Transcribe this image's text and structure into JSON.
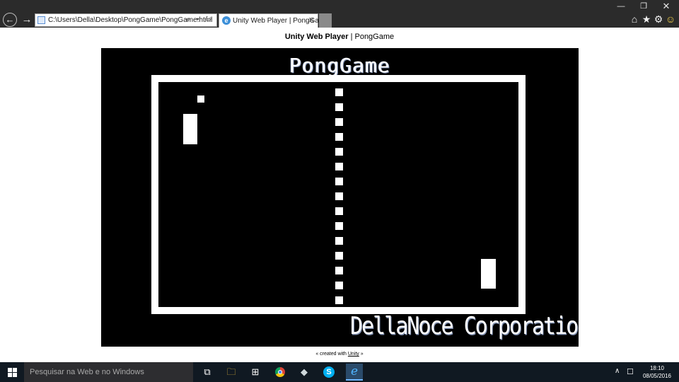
{
  "browser": {
    "address": "C:\\Users\\Della\\Desktop\\PongGame\\PongGame.html",
    "address_icons": "⌕ ▾ ↻",
    "tab_title": "Unity Web Player | PongGa...",
    "tab_close": "✕",
    "back": "←",
    "forward": "→",
    "window": {
      "minimize": "—",
      "restore": "❐",
      "close": "✕"
    },
    "tools": {
      "home": "⌂",
      "favorites": "★",
      "settings": "⚙",
      "feedback": "☺"
    }
  },
  "page": {
    "heading_bold": "Unity Web Player",
    "heading_rest": " | PongGame",
    "footer_prefix": "« created with ",
    "footer_link": "Unity",
    "footer_suffix": " »"
  },
  "game": {
    "title": "PongGame",
    "credit": "DellaNoce Corporation",
    "net_dash_count": 15
  },
  "taskbar": {
    "search_placeholder": "Pesquisar na Web e no Windows",
    "icons": [
      "windows-start-icon",
      "task-view-icon",
      "file-explorer-icon",
      "store-icon",
      "chrome-icon",
      "app-icon",
      "skype-icon",
      "internet-explorer-icon"
    ],
    "chevron": "∧",
    "notifications": "☐",
    "time": "18:10",
    "date": "08/05/2016"
  },
  "colors": {
    "chrome_bg": "#2b2b2b",
    "game_bg": "#000000",
    "game_fg": "#ffffff",
    "taskbar_bg": "#101922"
  }
}
